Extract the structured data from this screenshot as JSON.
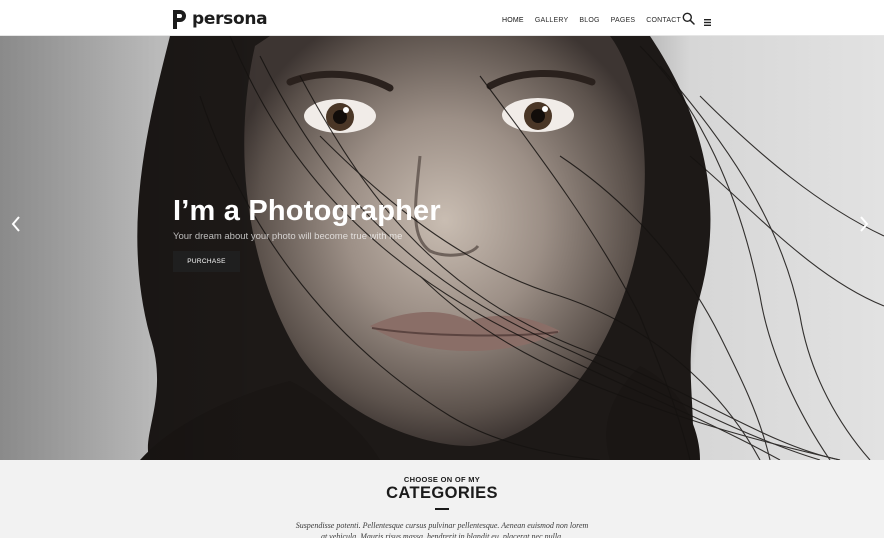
{
  "brand": {
    "name": "persona",
    "logo_icon": "p-logo-icon"
  },
  "nav": {
    "items": [
      {
        "label": "HOME"
      },
      {
        "label": "GALLERY"
      },
      {
        "label": "BLOG"
      },
      {
        "label": "PAGES"
      },
      {
        "label": "CONTACT"
      }
    ],
    "search_icon": "search-icon",
    "menu_icon": "hamburger-icon"
  },
  "hero": {
    "title": "I’m a Photographer",
    "subtitle": "Your dream about your photo will become true with me",
    "button_label": "PURCHASE",
    "prev_icon": "chevron-left-icon",
    "next_icon": "chevron-right-icon"
  },
  "categories": {
    "pretitle": "CHOOSE ON OF MY",
    "title": "CATEGORIES",
    "text": "Suspendisse potenti. Pellentesque cursus pulvinar pellentesque. Aenean euismod non lorem at vehicula. Mauris risus massa, hendrerit in blandit eu, placerat nec nulla."
  },
  "colors": {
    "header_bg": "#ffffff",
    "button_bg": "#1f1f1f",
    "section_bg": "#f2f2f2",
    "text_dark": "#1b1b1b"
  }
}
